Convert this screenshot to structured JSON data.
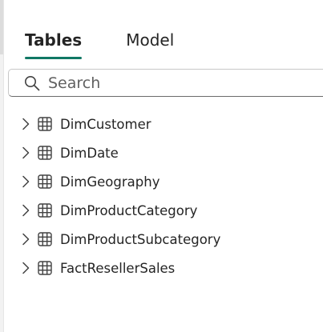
{
  "tabs": [
    {
      "label": "Tables",
      "active": true
    },
    {
      "label": "Model",
      "active": false
    }
  ],
  "search": {
    "placeholder": "Search",
    "value": ""
  },
  "tables": [
    {
      "name": "DimCustomer",
      "icon": "table-icon"
    },
    {
      "name": "DimDate",
      "icon": "table-icon"
    },
    {
      "name": "DimGeography",
      "icon": "table-icon"
    },
    {
      "name": "DimProductCategory",
      "icon": "table-icon"
    },
    {
      "name": "DimProductSubcategory",
      "icon": "table-icon"
    },
    {
      "name": "FactResellerSales",
      "icon": "table-icon"
    }
  ],
  "colors": {
    "accent": "#117865",
    "text": "#242424",
    "border": "#c7c7c7"
  }
}
